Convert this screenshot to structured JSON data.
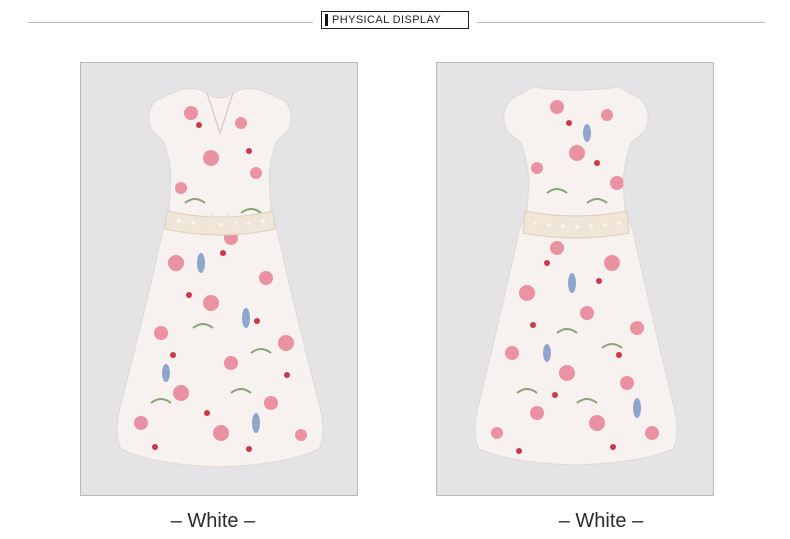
{
  "header": {
    "title": "PHYSICAL DISPLAY"
  },
  "products": [
    {
      "view": "front",
      "icon": "dress-front-photo-icon",
      "caption": "– White –"
    },
    {
      "view": "back",
      "icon": "dress-back-photo-icon",
      "caption": "– White –"
    }
  ],
  "colors": {
    "frame_background": "#e4e3e6",
    "dress_base": "#f7f2ef",
    "floral_pink": "#e8879a",
    "floral_red": "#c8394a",
    "floral_blue": "#7c98c8",
    "leaf_green": "#6f8f5a",
    "lace_waist": "#efe6d8"
  }
}
